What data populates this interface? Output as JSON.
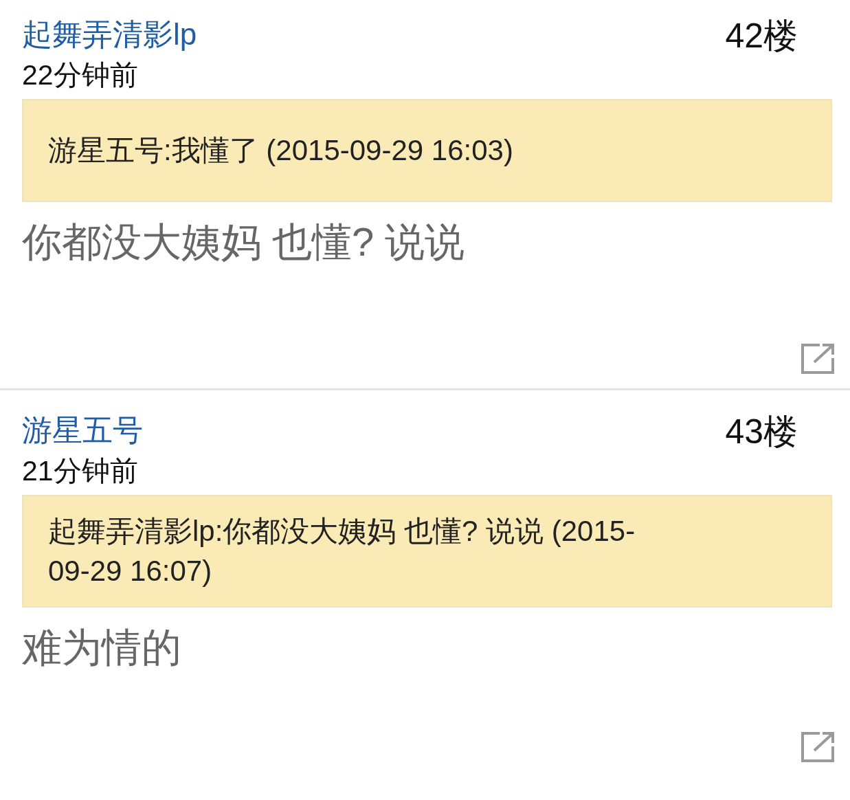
{
  "posts": [
    {
      "username": "起舞弄清影lp",
      "floor": "42楼",
      "time": "22分钟前",
      "quote": "游星五号:我懂了 (2015-09-29 16:03)",
      "content": "你都没大姨妈 也懂? 说说"
    },
    {
      "username": "游星五号",
      "floor": "43楼",
      "time": "21分钟前",
      "quote": "起舞弄清影lp:你都没大姨妈 也懂? 说说 (2015-09-29 16:07)",
      "content": "难为情的"
    }
  ]
}
